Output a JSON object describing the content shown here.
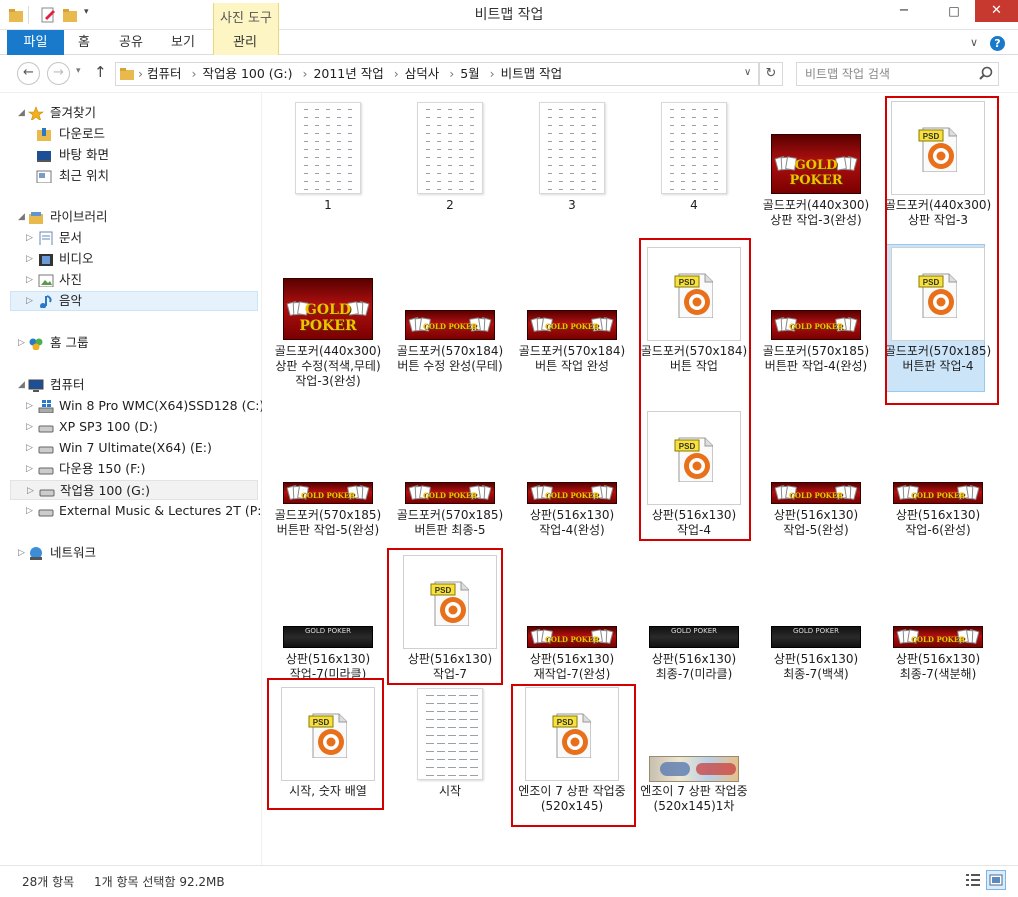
{
  "window": {
    "title": "비트맵 작업",
    "minimize": "−",
    "maximize": "□",
    "close": "✕"
  },
  "ribbon": {
    "context_group": "사진 도구",
    "tabs": [
      "파일",
      "홈",
      "공유",
      "보기",
      "관리"
    ]
  },
  "address": {
    "segments": [
      "컴퓨터",
      "작업용 100 (G:)",
      "2011년 작업",
      "삼덕사",
      "5월",
      "비트맵 작업"
    ],
    "search_placeholder": "비트맵 작업 검색"
  },
  "nav": {
    "favorites": {
      "label": "즐겨찾기",
      "items": [
        "다운로드",
        "바탕 화면",
        "최근 위치"
      ]
    },
    "libraries": {
      "label": "라이브러리",
      "items": [
        "문서",
        "비디오",
        "사진",
        "음악"
      ]
    },
    "homegroup": "홈 그룹",
    "computer": {
      "label": "컴퓨터",
      "items": [
        "Win 8 Pro WMC(X64)SSD128 (C:)",
        "XP SP3 100 (D:)",
        "Win 7 Ultimate(X64) (E:)",
        "다운용 150 (F:)",
        "작업용 100 (G:)",
        "External Music & Lectures 2T (P:)"
      ]
    },
    "network": "네트워크"
  },
  "files": [
    {
      "label": "1",
      "kind": "doc"
    },
    {
      "label": "2",
      "kind": "doc"
    },
    {
      "label": "3",
      "kind": "doc"
    },
    {
      "label": "4",
      "kind": "doc"
    },
    {
      "label": "골드포커(440x300) 상판 작업-3(완성)",
      "kind": "poker"
    },
    {
      "label": "골드포커(440x300) 상판 작업-3",
      "kind": "psd"
    },
    {
      "label": "골드포커(440x300) 상판 수정(적색,무테) 작업-3(완성)",
      "kind": "poker"
    },
    {
      "label": "골드포커(570x184) 버튼 수정 완성(무테)",
      "kind": "banner"
    },
    {
      "label": "골드포커(570x184) 버튼 작업 완성",
      "kind": "banner"
    },
    {
      "label": "골드포커(570x184) 버튼 작업",
      "kind": "psd"
    },
    {
      "label": "골드포커(570x185) 버튼판 작업-4(완성)",
      "kind": "banner"
    },
    {
      "label": "골드포커(570x185) 버튼판 작업-4",
      "kind": "psd"
    },
    {
      "label": "골드포커(570x185) 버튼판 작업-5(완성)",
      "kind": "banner"
    },
    {
      "label": "골드포커(570x185) 버튼판 최종-5",
      "kind": "banner"
    },
    {
      "label": "상판(516x130)작업-4(완성)",
      "kind": "banner"
    },
    {
      "label": "상판(516x130)작업-4",
      "kind": "psd"
    },
    {
      "label": "상판(516x130)작업-5(완성)",
      "kind": "banner"
    },
    {
      "label": "상판(516x130)작업-6(완성)",
      "kind": "banner"
    },
    {
      "label": "상판(516x130)작업-7(미라클)",
      "kind": "black"
    },
    {
      "label": "상판(516x130)작업-7",
      "kind": "psd"
    },
    {
      "label": "상판(516x130)재작업-7(완성)",
      "kind": "banner"
    },
    {
      "label": "상판(516x130)최종-7(미라클)",
      "kind": "black"
    },
    {
      "label": "상판(516x130)최종-7(백색)",
      "kind": "black"
    },
    {
      "label": "상판(516x130)최종-7(색분해)",
      "kind": "banner"
    },
    {
      "label": "시작, 숫자 배열",
      "kind": "psd"
    },
    {
      "label": "시작",
      "kind": "doc"
    },
    {
      "label": "엔조이 7 상판 작업중(520x145)",
      "kind": "psd"
    },
    {
      "label": "엔조이 7 상판 작업중(520x145)1차",
      "kind": "enjoy"
    }
  ],
  "thumb_text": {
    "logo": "GOLD POKER",
    "psd_badge": "PSD"
  },
  "status": {
    "count": "28개 항목",
    "selection": "1개 항목 선택함 92.2MB"
  },
  "colors": {
    "file_tab": "#1979ca",
    "close": "#c7392f",
    "highlight": "#d40000",
    "selection": "#cce4f7"
  }
}
